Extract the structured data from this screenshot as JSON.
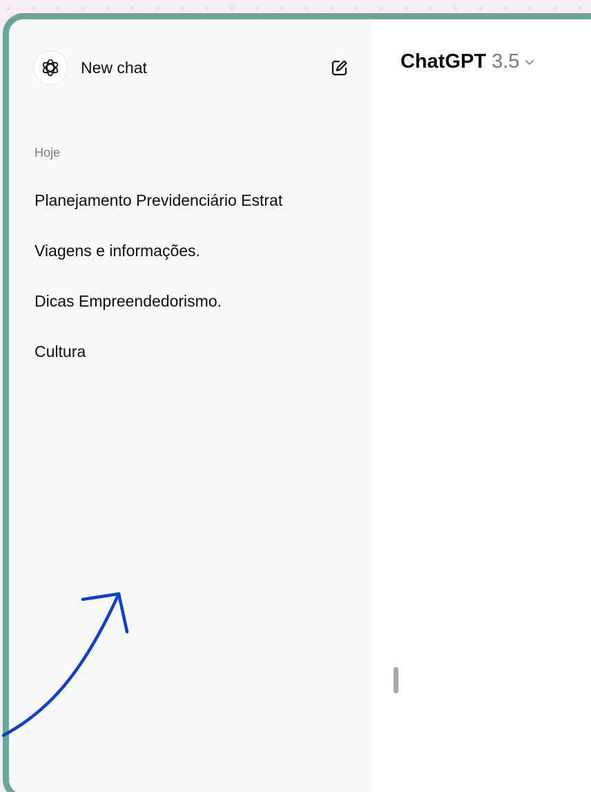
{
  "sidebar": {
    "new_chat_label": "New chat",
    "logo_icon": "openai-logo-icon",
    "edit_icon": "edit-pencil-icon",
    "section_today": "Hoje",
    "history": [
      {
        "title": "Planejamento Previdenciário Estrat"
      },
      {
        "title": "Viagens e informações."
      },
      {
        "title": "Dicas Empreendedorismo."
      },
      {
        "title": "Cultura"
      }
    ]
  },
  "header": {
    "model_name": "ChatGPT",
    "model_version": "3.5",
    "chevron_icon": "chevron-down-icon"
  },
  "colors": {
    "frame_border": "#6aa598",
    "sidebar_bg": "#f9f9f9",
    "arrow_annotation": "#0a3fd6",
    "page_background": "#f6ecf6"
  }
}
